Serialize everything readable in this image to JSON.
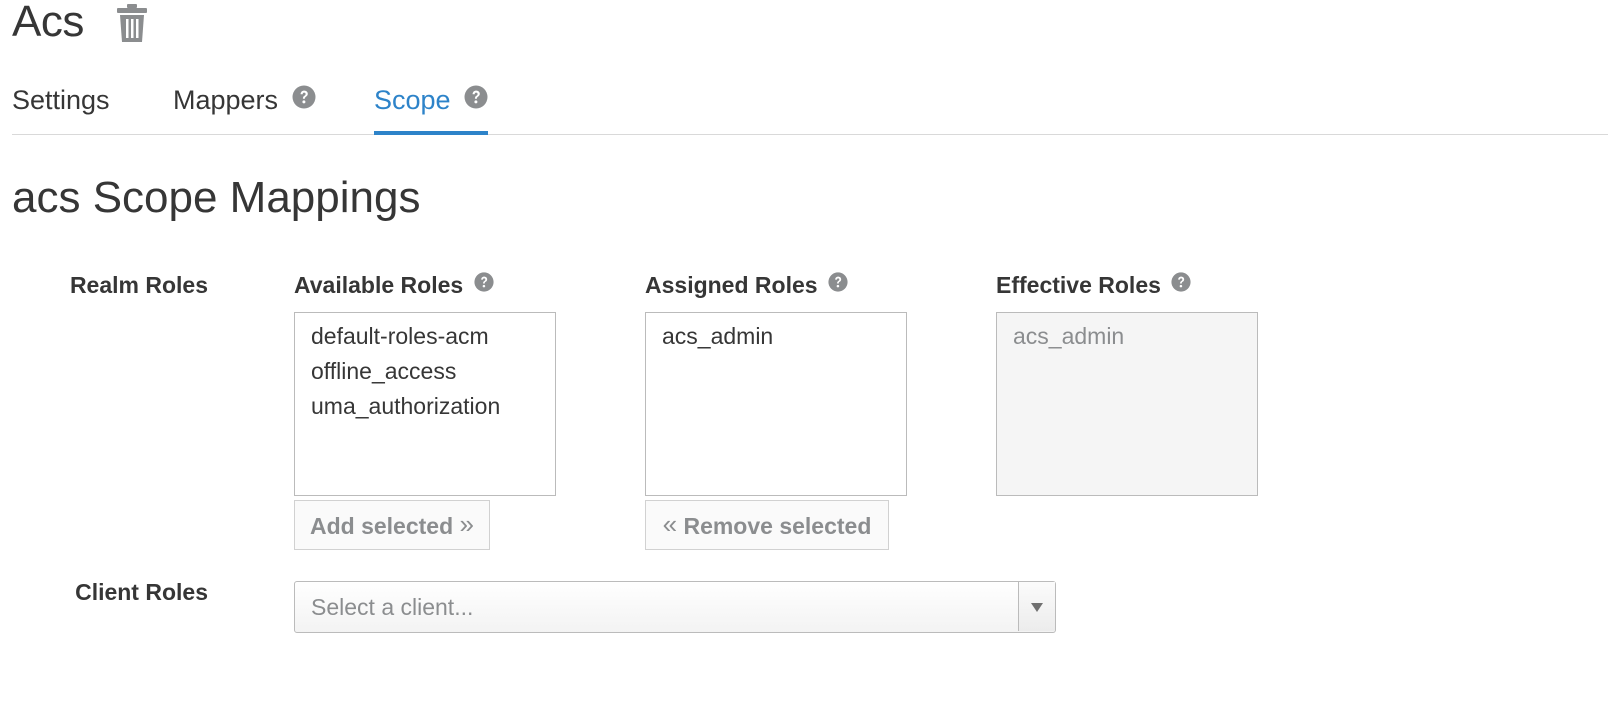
{
  "header": {
    "title": "Acs",
    "delete_icon": "trash-icon"
  },
  "tabs": [
    {
      "label": "Settings",
      "has_help": false,
      "active": false
    },
    {
      "label": "Mappers",
      "has_help": true,
      "active": false
    },
    {
      "label": "Scope",
      "has_help": true,
      "active": true
    }
  ],
  "section": {
    "heading": "acs Scope Mappings"
  },
  "realm_roles": {
    "label": "Realm Roles",
    "available": {
      "label": "Available Roles",
      "items": [
        "default-roles-acm",
        "offline_access",
        "uma_authorization"
      ],
      "button": "Add selected"
    },
    "assigned": {
      "label": "Assigned Roles",
      "items": [
        "acs_admin"
      ],
      "button": "Remove selected"
    },
    "effective": {
      "label": "Effective Roles",
      "items": [
        "acs_admin"
      ]
    }
  },
  "client_roles": {
    "label": "Client Roles",
    "placeholder": "Select a client..."
  },
  "colors": {
    "accent": "#2d83c9",
    "text": "#363636",
    "muted_text": "#8b8d8f",
    "help_icon": "#8b8d8f",
    "border": "#bbbbbb",
    "disabled_background": "#f5f5f5"
  }
}
